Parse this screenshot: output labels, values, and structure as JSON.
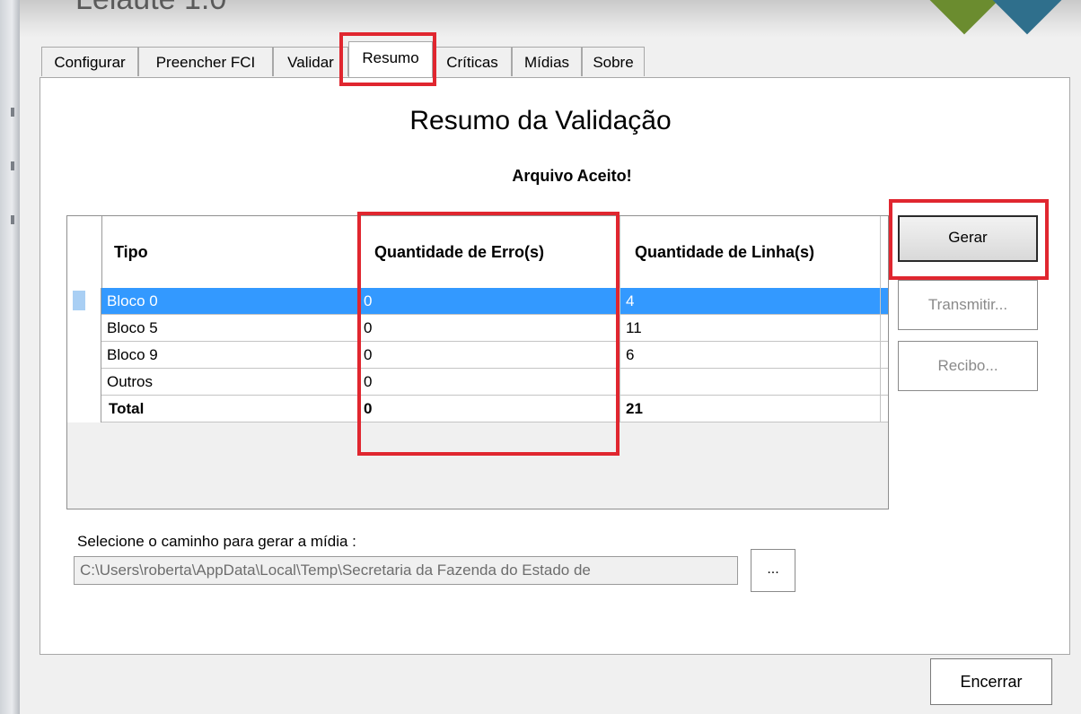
{
  "window": {
    "title": "Leiaute 1.0"
  },
  "tabs": [
    {
      "label": "Configurar"
    },
    {
      "label": "Preencher FCI"
    },
    {
      "label": "Validar"
    },
    {
      "label": "Resumo"
    },
    {
      "label": "Críticas"
    },
    {
      "label": "Mídias"
    },
    {
      "label": "Sobre"
    }
  ],
  "active_tab": "Resumo",
  "panel": {
    "title": "Resumo da Validação",
    "status": "Arquivo Aceito!"
  },
  "grid": {
    "columns": [
      "Tipo",
      "Quantidade de Erro(s)",
      "Quantidade de Linha(s)"
    ],
    "rows": [
      {
        "tipo": "Bloco 0",
        "erros": "0",
        "linhas": "4"
      },
      {
        "tipo": "Bloco 5",
        "erros": "0",
        "linhas": "11"
      },
      {
        "tipo": "Bloco 9",
        "erros": "0",
        "linhas": "6"
      },
      {
        "tipo": "Outros",
        "erros": "0",
        "linhas": ""
      },
      {
        "tipo": "Total",
        "erros": "0",
        "linhas": "21"
      }
    ],
    "selected_row": 0
  },
  "buttons": {
    "gerar": "Gerar",
    "transmitir": "Transmitir...",
    "recibo": "Recibo...",
    "browse": "...",
    "encerrar": "Encerrar"
  },
  "path": {
    "label": "Selecione o caminho para gerar a mídia :",
    "value": "C:\\Users\\roberta\\AppData\\Local\\Temp\\Secretaria da Fazenda do Estado de"
  },
  "colors": {
    "highlight": "#e0262f",
    "selection": "#3399ff"
  }
}
